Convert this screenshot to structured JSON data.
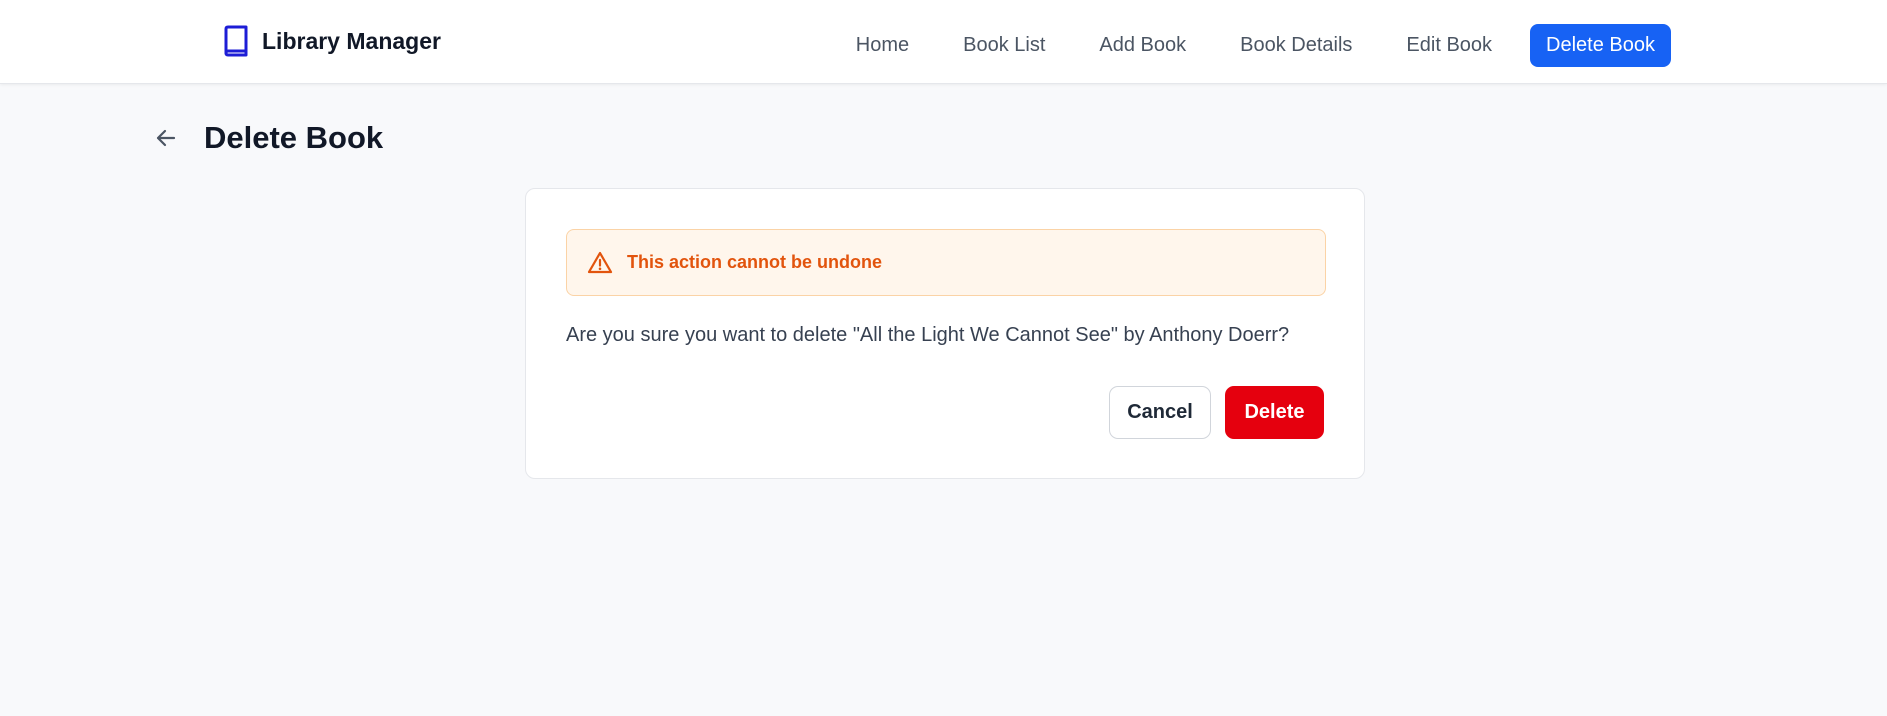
{
  "app": {
    "name": "Library Manager"
  },
  "nav": {
    "items": [
      {
        "label": "Home"
      },
      {
        "label": "Book List"
      },
      {
        "label": "Add Book"
      },
      {
        "label": "Book Details"
      },
      {
        "label": "Edit Book"
      },
      {
        "label": "Delete Book",
        "active": true
      }
    ]
  },
  "page": {
    "title": "Delete Book"
  },
  "dialog": {
    "warning": "This action cannot be undone",
    "message": "Are you sure you want to delete \"All the Light We Cannot See\" by Anthony Doerr?",
    "cancel_label": "Cancel",
    "delete_label": "Delete"
  },
  "colors": {
    "primary": "#1762f4",
    "danger": "#e5000e",
    "warning_text": "#e2540d",
    "warning_bg": "#fff6ec"
  },
  "icons": {
    "brand": "book-icon",
    "back": "arrow-left-icon",
    "warning": "warning-triangle-icon"
  }
}
